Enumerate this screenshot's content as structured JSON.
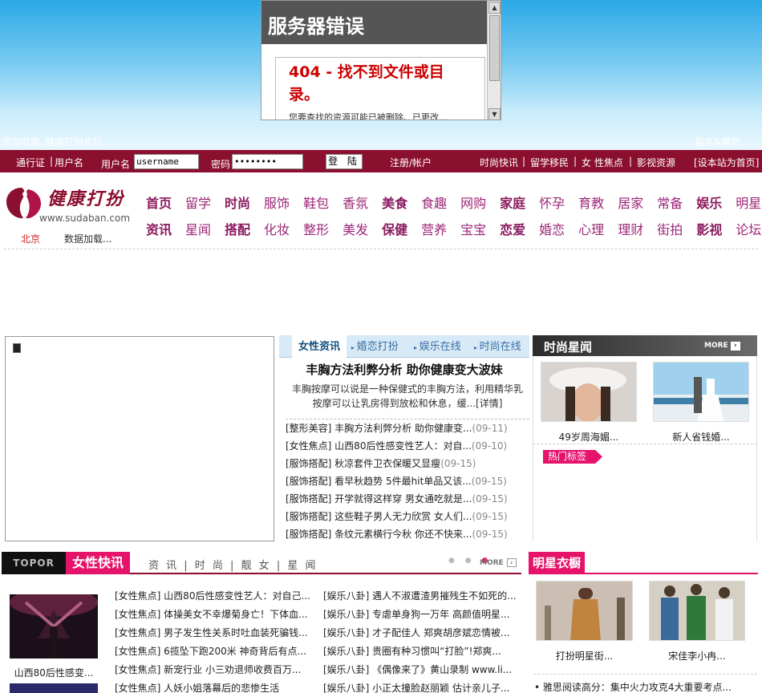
{
  "top": {
    "error_title": "服务器错误",
    "error_404": "404 - 找不到文件或目录。",
    "error_tip": "您要查找的资源可能已被删除、已更改...",
    "add_fav": "添加收藏",
    "forum_link": "健康打扮论坛",
    "help": "留言&帮助"
  },
  "login": {
    "passport": "通行证",
    "sep": "|",
    "username_tab": "用户名",
    "username_label": "用户名",
    "username_value": "username",
    "password_label": "密码",
    "password_value": "••••••••",
    "login_btn": "登 陆",
    "register": "注册/帐户",
    "links": [
      "时尚快讯",
      "留学移民",
      "女 性焦点",
      "影视资源"
    ],
    "homepage": "[设本站为首页]"
  },
  "logo": {
    "name": "健康打扮",
    "url": "www.sudaban.com",
    "city": "北京",
    "weather": "数据加载..."
  },
  "nav": {
    "row1": [
      {
        "t": "首页",
        "b": true
      },
      {
        "t": "留学",
        "b": false
      },
      {
        "t": "时尚",
        "b": true
      },
      {
        "t": "服饰",
        "b": false
      },
      {
        "t": "鞋包",
        "b": false
      },
      {
        "t": "香氛",
        "b": false
      },
      {
        "t": "美食",
        "b": true
      },
      {
        "t": "食趣",
        "b": false
      },
      {
        "t": "网购",
        "b": false
      },
      {
        "t": "家庭",
        "b": true
      },
      {
        "t": "怀孕",
        "b": false
      },
      {
        "t": "育教",
        "b": false
      },
      {
        "t": "居家",
        "b": false
      },
      {
        "t": "常备",
        "b": false
      },
      {
        "t": "娱乐",
        "b": true
      },
      {
        "t": "明星",
        "b": false
      }
    ],
    "row2": [
      {
        "t": "资讯",
        "b": true
      },
      {
        "t": "星闻",
        "b": false
      },
      {
        "t": "搭配",
        "b": true
      },
      {
        "t": "化妆",
        "b": false
      },
      {
        "t": "整形",
        "b": false
      },
      {
        "t": "美发",
        "b": false
      },
      {
        "t": "保健",
        "b": true
      },
      {
        "t": "营养",
        "b": false
      },
      {
        "t": "宝宝",
        "b": false
      },
      {
        "t": "恋爱",
        "b": true
      },
      {
        "t": "婚恋",
        "b": false
      },
      {
        "t": "心理",
        "b": false
      },
      {
        "t": "理财",
        "b": false
      },
      {
        "t": "街拍",
        "b": false
      },
      {
        "t": "影视",
        "b": true
      },
      {
        "t": "论坛",
        "b": false
      }
    ]
  },
  "tabs": {
    "active": "女性资讯",
    "others": [
      "婚恋打扮",
      "娱乐在线",
      "时尚在线"
    ]
  },
  "headline": {
    "title": "丰胸方法利弊分析 助你健康变大波妹",
    "summary": "丰胸按摩可以说是一种保健式的丰胸方法，利用精华乳按摩可以让乳房得到放松和休息，缓...[详情]"
  },
  "news": [
    {
      "text": "[整形美容] 丰胸方法利弊分析 助你健康变...",
      "date": "(09-11)"
    },
    {
      "text": "[女性焦点] 山西80后性感变性艺人：对自...",
      "date": "(09-10)"
    },
    {
      "text": "[服饰搭配] 秋凉套件卫衣保暖又显瘦",
      "date": "(09-15)"
    },
    {
      "text": "[服饰搭配] 看早秋趋势 5件最hit单品又该...",
      "date": "(09-15)"
    },
    {
      "text": "[服饰搭配] 开学就得这样穿 男女通吃就是...",
      "date": "(09-15)"
    },
    {
      "text": "[服饰搭配] 这些鞋子男人无力欣赏 女人们...",
      "date": "(09-15)"
    },
    {
      "text": "[服饰搭配] 条纹元素横行今秋 你还不快来...",
      "date": "(09-15)"
    }
  ],
  "stars": {
    "title": "时尚星闻",
    "more": "MORE",
    "items": [
      "49岁周海媚...",
      "新人省钱婚..."
    ],
    "hot_tag": "热门标签"
  },
  "section2": {
    "topor": "TOPOR",
    "title": "女性快讯",
    "sub": "资 讯 | 时 尚 | 靓 女 | 星 闻",
    "more": "MORE",
    "thumb_caption": "山西80后性感变...",
    "col1": [
      "[女性焦点] 山西80后性感变性艺人：对自己...",
      "[女性焦点] 体操美女不幸爆菊身亡！下体血...",
      "[女性焦点] 男子发生性关系时吐血装死骗钱...",
      "[女性焦点] 6揽坠下跑200米 神奇背后有点...",
      "[女性焦点] 新宠行业 小三劝退师收费百万...",
      "[女性焦点] 人妖小姐落幕后的悲惨生活"
    ],
    "col2": [
      "[娱乐八卦] 遇人不淑遭渣男摧残生不如死的...",
      "[娱乐八卦] 专虐单身狗一万年 高颜值明星...",
      "[娱乐八卦] 才子配佳人 郑爽胡彦斌恋情被...",
      "[娱乐八卦] 贵圈有种习惯叫“打脸”!郑爽...",
      "[娱乐八卦] 《偶像来了》黄山录制 www.li...",
      "[娱乐八卦] 小正太撞脸赵丽颖 估计亲儿子..."
    ]
  },
  "wardrobe": {
    "title": "明星衣橱",
    "items": [
      "打扮明星街...",
      "宋佳李小冉..."
    ],
    "bullet": "• 雅思阅读高分：集中火力攻克4大重要考点..."
  }
}
